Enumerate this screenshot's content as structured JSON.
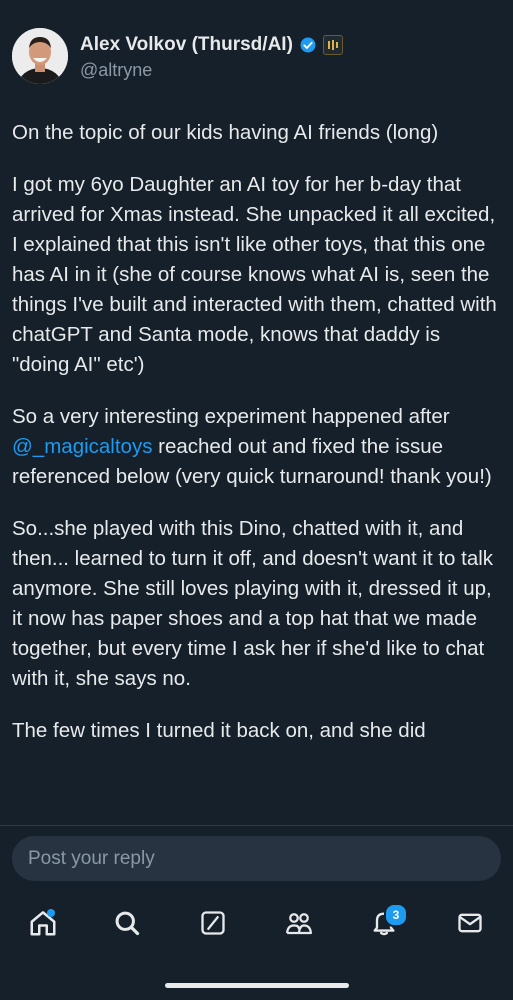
{
  "author": {
    "name": "Alex Volkov (Thursd/AI)",
    "handle": "@altryne",
    "verified_icon": "verified-badge-icon",
    "affiliate_icon": "affiliate-badge-icon"
  },
  "tweet": {
    "p1": "On the topic of our kids having AI friends (long)",
    "p2": "I got my 6yo Daughter an AI toy for her b-day that arrived for Xmas instead. She unpacked it all excited, I explained that this isn't like other toys, that this one has AI in it (she of course knows what AI is, seen the things I've built and interacted with them, chatted with chatGPT and Santa mode, knows that daddy is \"doing AI\" etc')",
    "p3_before": "So a very interesting experiment happened after ",
    "p3_mention": "@_magicaltoys",
    "p3_after": " reached out and fixed the issue referenced below (very quick turnaround! thank you!)",
    "p4": "So...she played with this Dino, chatted with it, and then... learned to turn it off, and doesn't want it to talk anymore. She still loves playing with it, dressed it up, it now has paper shoes and a top hat that we made together, but every time I ask her if she'd like to chat with it, she says no.",
    "p5": "The few times I turned it back on, and she did"
  },
  "reply": {
    "placeholder": "Post your reply"
  },
  "nav": {
    "items": [
      "home",
      "search",
      "grok",
      "communities",
      "notifications",
      "messages"
    ],
    "notifications_count": "3"
  },
  "colors": {
    "background": "#15202b",
    "accent": "#1d9bf0",
    "text": "#e7e9ea",
    "muted": "#8b98a5"
  }
}
